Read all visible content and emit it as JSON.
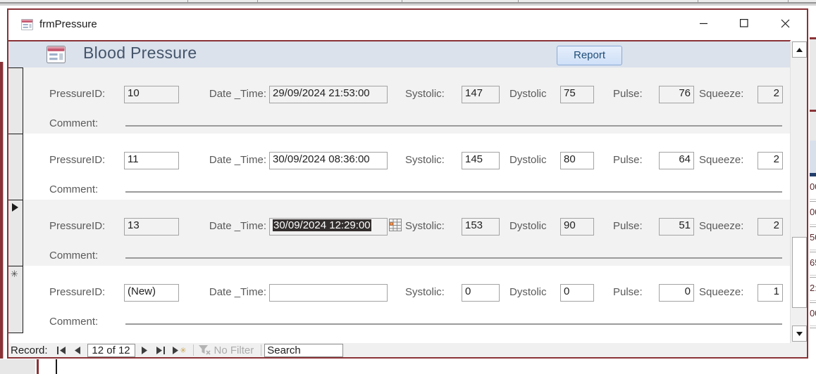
{
  "window": {
    "title": "frmPressure"
  },
  "header": {
    "title": "Blood Pressure",
    "report_button_label": "Report"
  },
  "field_labels": {
    "pressure_id": "PressureID:",
    "date_time": "Date _Time:",
    "systolic": "Systolic:",
    "dystolic": "Dystolic",
    "pulse": "Pulse:",
    "squeeze": "Squeeze:",
    "comment": "Comment:"
  },
  "records": [
    {
      "pressure_id": "10",
      "date_time": "29/09/2024 21:53:00",
      "systolic": "147",
      "dystolic": "75",
      "pulse": "76",
      "squeeze": "2",
      "comment": "",
      "is_current": false,
      "is_new": false
    },
    {
      "pressure_id": "11",
      "date_time": "30/09/2024 08:36:00",
      "systolic": "145",
      "dystolic": "80",
      "pulse": "64",
      "squeeze": "2",
      "comment": "",
      "is_current": false,
      "is_new": false
    },
    {
      "pressure_id": "13",
      "date_time": "30/09/2024 12:29:00",
      "systolic": "153",
      "dystolic": "90",
      "pulse": "51",
      "squeeze": "2",
      "comment": "",
      "is_current": true,
      "is_new": false,
      "date_time_selected": true
    },
    {
      "pressure_id": "(New)",
      "date_time": "",
      "systolic": "0",
      "dystolic": "0",
      "pulse": "0",
      "squeeze": "1",
      "comment": "",
      "is_current": false,
      "is_new": true
    }
  ],
  "nav": {
    "record_label": "Record:",
    "position_text": "12 of 12",
    "no_filter_label": "No Filter",
    "search_placeholder": "Search"
  },
  "icons": {
    "current_record_arrow": "▶",
    "new_record_star": "✳",
    "nav_new_star": "✳",
    "form_icon": "access-form",
    "date_picker": "calendar-grid",
    "filter": "funnel-x",
    "minimize": "—",
    "maximize": "□",
    "close": "✕"
  },
  "background_window": {
    "partial_cell_values": [
      "00",
      "00",
      "50",
      "65",
      "2:",
      "00"
    ]
  },
  "colors": {
    "window_border": "#8a3236",
    "header_bg": "#dbe2ec",
    "header_title": "#44546a",
    "report_button_bg": "#cfe0f7",
    "report_button_border": "#89a9d6",
    "row_alt_bg": "#f2f2f2",
    "label_text": "#5a5a5a",
    "selection_bg": "#332f2e",
    "nav_star": "#caa24f"
  }
}
